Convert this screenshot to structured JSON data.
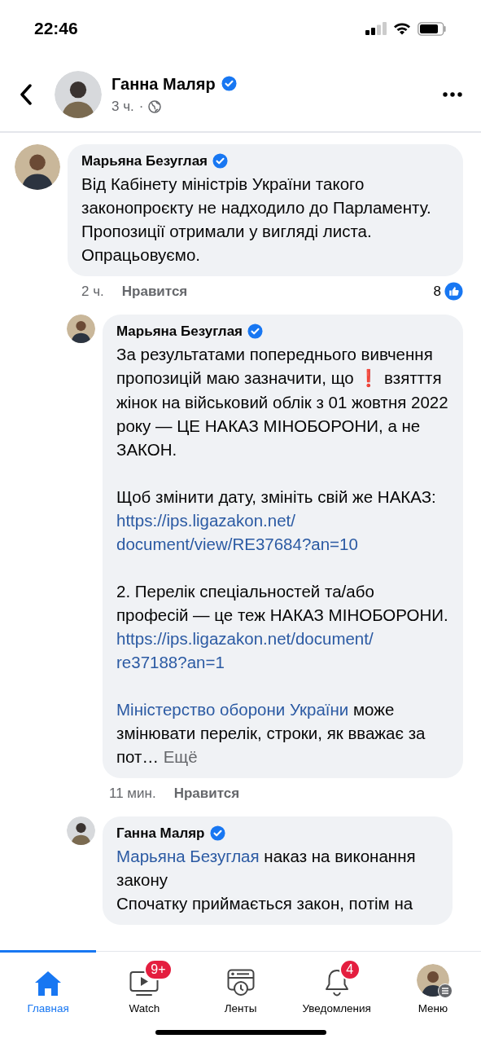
{
  "status_bar": {
    "time": "22:46"
  },
  "post_header": {
    "author": "Ганна Маляр",
    "verified": true,
    "time": "3 ч.",
    "separator": "·"
  },
  "comments": [
    {
      "author": "Марьяна Безуглая",
      "verified": true,
      "reply": false,
      "time": "2 ч.",
      "like_label": "Нравится",
      "reaction_count": "8",
      "paragraphs": [
        {
          "kind": "block",
          "segments": [
            {
              "kind": "text",
              "text": "Від Кабінету міністрів України такого законопроєкту не надходило до Парламенту. Пропозиції отримали у вигляді листа. Опрацьовуємо."
            }
          ]
        }
      ]
    },
    {
      "author": "Марьяна Безуглая",
      "verified": true,
      "reply": true,
      "time": "11 мин.",
      "like_label": "Нравится",
      "paragraphs": [
        {
          "kind": "block",
          "segments": [
            {
              "kind": "text",
              "text": "За результатами попереднього вивчення пропозицій маю зазначити, що "
            },
            {
              "kind": "emoji",
              "text": "❗"
            },
            {
              "kind": "text",
              "text": " взятття жінок на військовий облік з 01 жовтня 2022 року — ЦЕ НАКАЗ МІНОБОРОНИ, а не ЗАКОН."
            }
          ]
        },
        {
          "kind": "block",
          "segments": [
            {
              "kind": "text",
              "text": "Щоб змінити дату, змініть свій же НАКАЗ: "
            },
            {
              "kind": "link",
              "text": "https://ips.ligazakon.net/"
            },
            {
              "kind": "link",
              "text": "document/view/RE37684?an=10"
            }
          ]
        },
        {
          "kind": "block",
          "segments": [
            {
              "kind": "text",
              "text": "2. Перелік спеціальностей та/або професій — це теж НАКАЗ МІНОБОРОНИ."
            }
          ]
        },
        {
          "kind": "line",
          "segments": [
            {
              "kind": "link",
              "text": "https://ips.ligazakon.net/document/"
            },
            {
              "kind": "link",
              "text": "re37188?an=1"
            }
          ]
        },
        {
          "kind": "block",
          "segments": [
            {
              "kind": "link",
              "text": "Міністерство оборони України"
            },
            {
              "kind": "text",
              "text": " може змінювати перелік, строки, як вважає за пот… "
            },
            {
              "kind": "more",
              "text": "Ещё"
            }
          ]
        }
      ]
    },
    {
      "author": "Ганна Маляр",
      "verified": true,
      "reply": true,
      "paragraphs": [
        {
          "kind": "block",
          "segments": [
            {
              "kind": "link",
              "text": "Марьяна Безуглая"
            },
            {
              "kind": "text",
              "text": " наказ на виконання закону"
            }
          ]
        },
        {
          "kind": "line",
          "segments": [
            {
              "kind": "text",
              "text": "Спочатку приймається закон, потім на"
            }
          ]
        }
      ]
    }
  ],
  "tab_bar": {
    "tabs": [
      {
        "label": "Главная",
        "selected": true
      },
      {
        "label": "Watch",
        "badge": "9+",
        "selected": false
      },
      {
        "label": "Ленты",
        "selected": false
      },
      {
        "label": "Уведомления",
        "badge": "4",
        "selected": false
      },
      {
        "label": "Меню",
        "selected": false
      }
    ]
  }
}
